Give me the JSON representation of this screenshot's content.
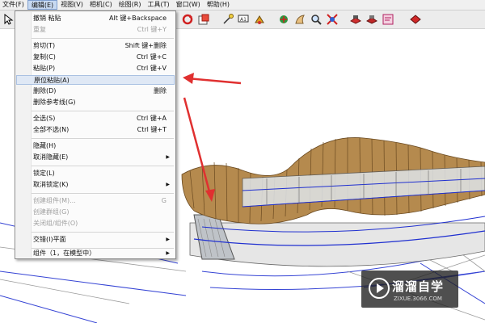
{
  "menubar": {
    "items": [
      {
        "label": "文件(F)"
      },
      {
        "label": "编辑(E)",
        "active": true
      },
      {
        "label": "视图(V)"
      },
      {
        "label": "相机(C)"
      },
      {
        "label": "绘图(R)"
      },
      {
        "label": "工具(T)"
      },
      {
        "label": "窗口(W)"
      },
      {
        "label": "帮助(H)"
      }
    ]
  },
  "edit_menu": {
    "items": [
      {
        "label": "撤销 粘贴",
        "shortcut": "Alt 键+Backspace"
      },
      {
        "label": "重复",
        "shortcut": "Ctrl 键+Y",
        "disabled": true
      },
      {
        "label": "剪切(T)",
        "shortcut": "Shift 键+删除"
      },
      {
        "label": "复制(C)",
        "shortcut": "Ctrl 键+C"
      },
      {
        "label": "粘贴(P)",
        "shortcut": "Ctrl 键+V"
      },
      {
        "label": "原位粘贴(A)",
        "highlighted": true
      },
      {
        "label": "删除(D)",
        "shortcut": "删除"
      },
      {
        "label": "删除参考线(G)"
      },
      {
        "label": "全选(S)",
        "shortcut": "Ctrl 键+A"
      },
      {
        "label": "全部不选(N)",
        "shortcut": "Ctrl 键+T"
      },
      {
        "label": "隐藏(H)"
      },
      {
        "label": "取消隐藏(E)",
        "submenu": true
      },
      {
        "label": "锁定(L)"
      },
      {
        "label": "取消锁定(K)",
        "submenu": true
      },
      {
        "label": "创建组件(M)...",
        "shortcut": "G",
        "disabled": true
      },
      {
        "label": "创建群组(G)",
        "disabled": true
      },
      {
        "label": "关闭组/组件(O)",
        "disabled": true
      },
      {
        "label": "交错(I)平面",
        "submenu": true
      },
      {
        "label": "组件（1，在模型中）",
        "submenu": true
      }
    ]
  },
  "toolbar": {
    "icons": [
      "select-icon",
      "rotate-icon",
      "scale-icon",
      "text-icon",
      "dimension-icon",
      "paint-bucket-icon",
      "walk-icon",
      "orbit-icon",
      "look-around-icon",
      "zoom-icon",
      "zoom-extents-icon",
      "component-icon",
      "warehouse-icon",
      "share-icon",
      "ruby-icon"
    ]
  },
  "colors": {
    "menu_highlight": "#dfe8f5",
    "annotation_arrow": "#e03030",
    "wood": "#b58a4e",
    "edges": "#1f2fd0"
  },
  "watermark": {
    "title": "溜溜自学",
    "url": "ZIXUE.3066.COM"
  }
}
